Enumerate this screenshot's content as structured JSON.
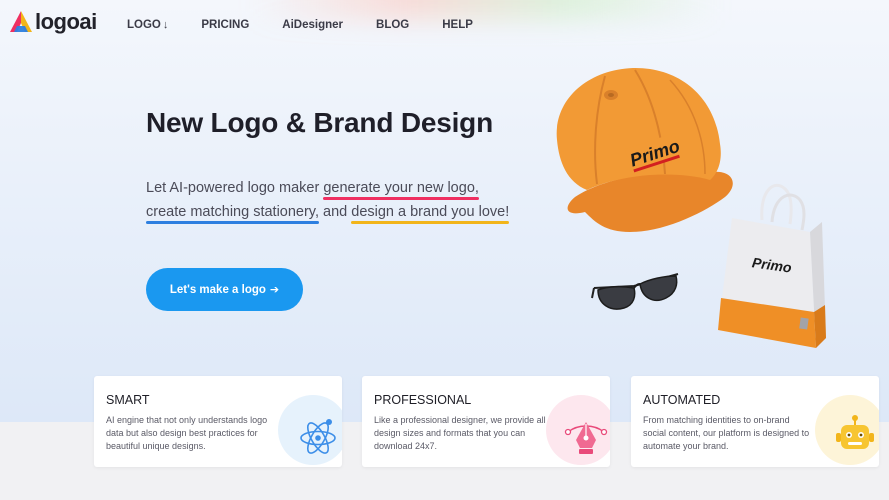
{
  "brand": {
    "name": "logoai"
  },
  "nav": [
    {
      "label": "LOGO",
      "has_arrow": true
    },
    {
      "label": "PRICING"
    },
    {
      "label": "AiDesigner"
    },
    {
      "label": "BLOG"
    },
    {
      "label": "HELP"
    }
  ],
  "nav_arrow": "↓",
  "hero": {
    "title": "New Logo & Brand Design",
    "line1_prefix": "Let AI-powered logo maker ",
    "line1_link": "generate your new logo,",
    "line2_link1": "create matching stationery,",
    "line2_mid": " and ",
    "line2_link2": "design a brand you love!",
    "cta_label": "Let's make a logo",
    "cta_icon": "➔"
  },
  "products": {
    "brand_text": "Primo"
  },
  "cards": [
    {
      "title": "SMART",
      "text": "AI engine that not only understands logo data but also design best practices for beautiful unique designs.",
      "icon": "atom-icon"
    },
    {
      "title": "PROFESSIONAL",
      "text": "Like a professional designer, we provide all design sizes and formats that you can download 24x7.",
      "icon": "pen-tool-icon"
    },
    {
      "title": "AUTOMATED",
      "text": "From matching identities to on-brand social content, our platform is designed to automate your brand.",
      "icon": "robot-icon"
    }
  ],
  "colors": {
    "accent": "#1a98f0",
    "underline_red": "#ef2f61",
    "underline_blue": "#2d7fe0",
    "underline_yellow": "#f2b51a",
    "cap_orange": "#f29a35"
  }
}
